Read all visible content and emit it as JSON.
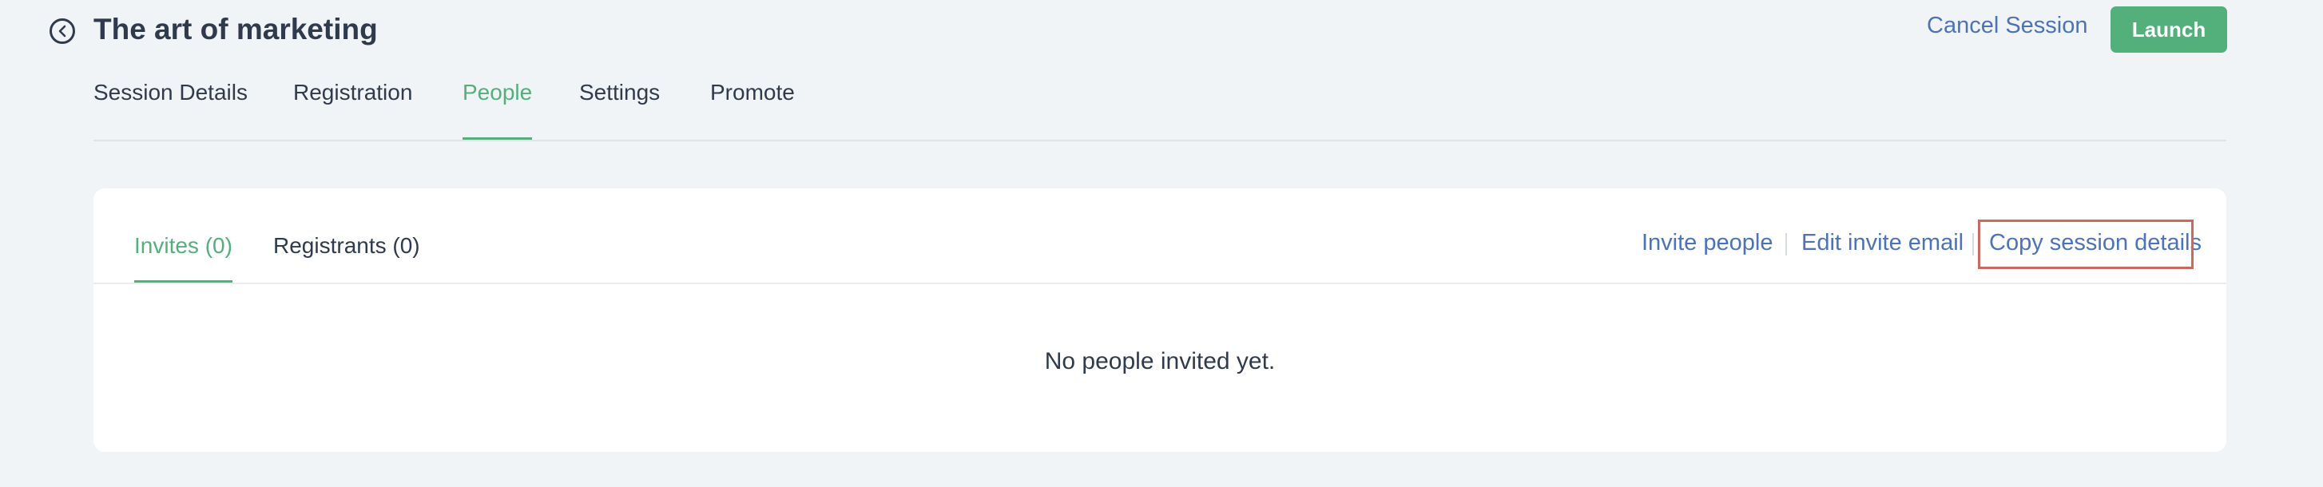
{
  "header": {
    "title": "The art of marketing",
    "cancel_label": "Cancel Session",
    "launch_label": "Launch"
  },
  "top_tabs": [
    {
      "label": "Session Details",
      "active": false
    },
    {
      "label": "Registration",
      "active": false
    },
    {
      "label": "People",
      "active": true
    },
    {
      "label": "Settings",
      "active": false
    },
    {
      "label": "Promote",
      "active": false
    }
  ],
  "people": {
    "tabs": [
      {
        "label": "Invites (0)",
        "active": true
      },
      {
        "label": "Registrants (0)",
        "active": false
      }
    ],
    "actions": {
      "invite_people": "Invite people",
      "edit_invite_email": "Edit invite email",
      "copy_session_details": "Copy session details"
    },
    "empty_message": "No people invited yet."
  },
  "colors": {
    "accent": "#53b07b",
    "link": "#4c73b8",
    "text": "#2f3b4c",
    "background": "#f1f4f7",
    "highlight": "#c86b5c"
  },
  "icons": {
    "back": "chevron-left-circle-icon"
  }
}
